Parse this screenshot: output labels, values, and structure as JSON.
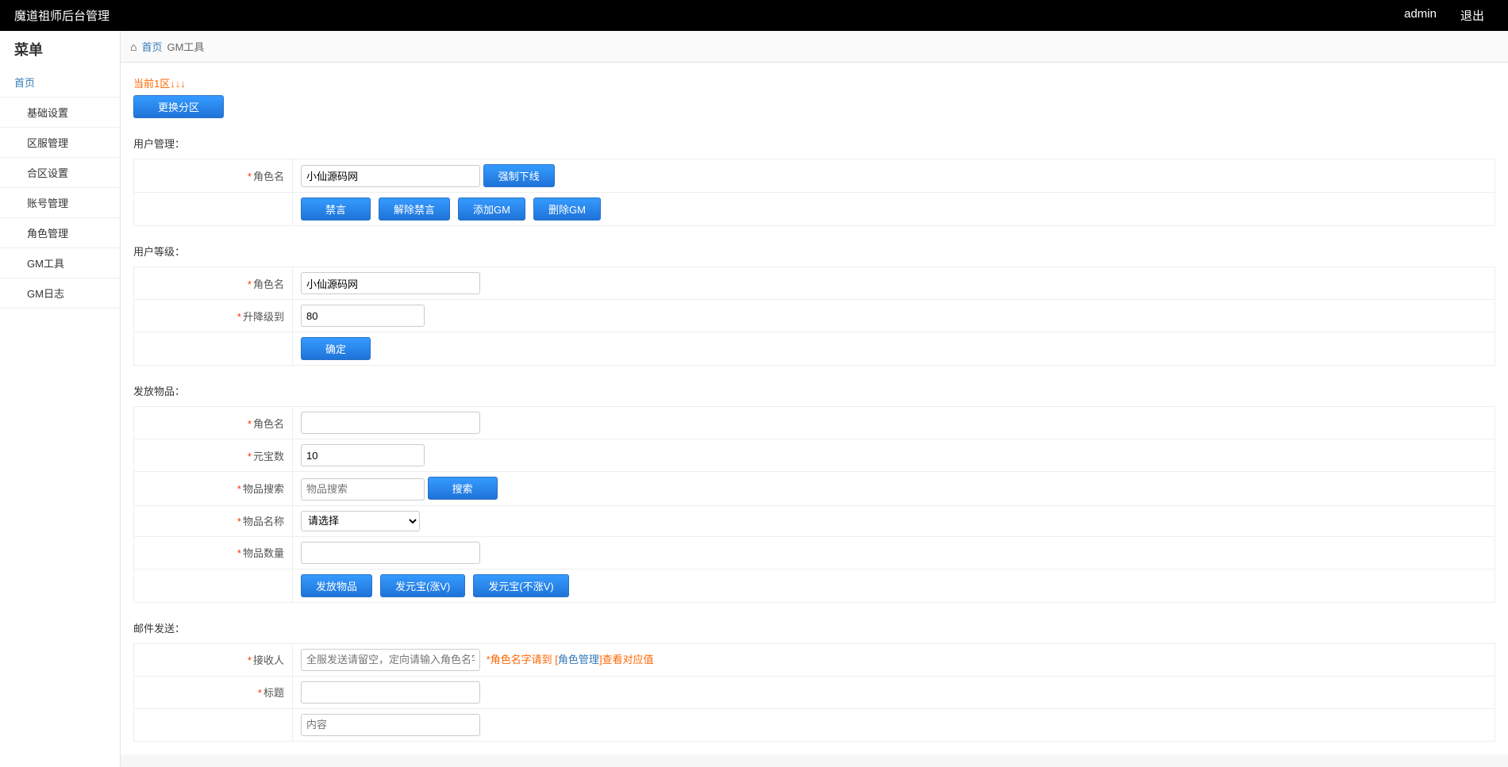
{
  "header": {
    "title": "魔道祖师后台管理",
    "user": "admin",
    "logout": "退出"
  },
  "sidebar": {
    "title": "菜单",
    "items": [
      {
        "label": "首页",
        "level": "top"
      },
      {
        "label": "基础设置",
        "level": "sub"
      },
      {
        "label": "区服管理",
        "level": "sub"
      },
      {
        "label": "合区设置",
        "level": "sub"
      },
      {
        "label": "账号管理",
        "level": "sub"
      },
      {
        "label": "角色管理",
        "level": "sub"
      },
      {
        "label": "GM工具",
        "level": "sub"
      },
      {
        "label": "GM日志",
        "level": "sub"
      }
    ]
  },
  "breadcrumb": {
    "home": "首页",
    "current": "GM工具"
  },
  "zone": {
    "status": "当前1区↓↓↓",
    "switch_btn": "更换分区"
  },
  "user_mgmt": {
    "title": "用户管理：",
    "role_label": "角色名",
    "role_value": "小仙源码网",
    "force_offline": "强制下线",
    "mute": "禁言",
    "unmute": "解除禁言",
    "add_gm": "添加GM",
    "del_gm": "删除GM"
  },
  "user_level": {
    "title": "用户等级：",
    "role_label": "角色名",
    "role_value": "小仙源码网",
    "level_label": "升降级到",
    "level_value": "80",
    "confirm": "确定"
  },
  "give_item": {
    "title": "发放物品：",
    "role_label": "角色名",
    "role_value": "",
    "yuanbao_label": "元宝数",
    "yuanbao_value": "10",
    "search_label": "物品搜索",
    "search_placeholder": "物品搜索",
    "search_btn": "搜索",
    "item_name_label": "物品名称",
    "item_name_placeholder": "请选择",
    "item_qty_label": "物品数量",
    "item_qty_value": "",
    "give_item_btn": "发放物品",
    "give_yb_v": "发元宝(涨V)",
    "give_yb_nov": "发元宝(不涨V)"
  },
  "mail": {
    "title": "邮件发送：",
    "recipient_label": "接收人",
    "recipient_placeholder": "全服发送请留空，定向请输入角色名字",
    "recipient_hint_pre": "*角色名字请到 [",
    "recipient_hint_link": "角色管理",
    "recipient_hint_post": "]查看对应值",
    "subject_label": "标题",
    "content_placeholder": "内容"
  }
}
